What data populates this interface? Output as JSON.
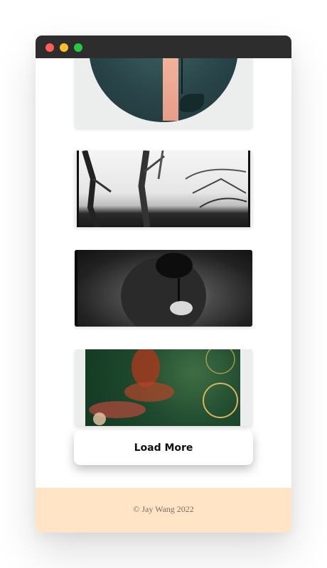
{
  "window": {
    "buttons": {
      "close": "close",
      "minimize": "minimize",
      "maximize": "maximize"
    }
  },
  "gallery": {
    "items": [
      {
        "alt": ""
      },
      {
        "alt": ""
      },
      {
        "alt": ""
      },
      {
        "alt": ""
      }
    ]
  },
  "load_more": {
    "label": "Load More"
  },
  "footer": {
    "text": "© Jay Wang 2022"
  },
  "colors": {
    "titlebar": "#2d2d2d",
    "close": "#ff5f57",
    "minimize": "#febc2e",
    "maximize": "#28c840",
    "footer_bg": "#ffe4c5"
  }
}
